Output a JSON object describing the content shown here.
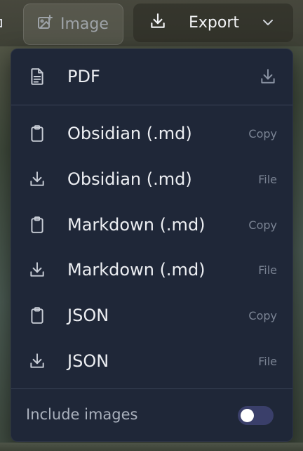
{
  "toolbar": {
    "image_label": "Image",
    "export_label": "Export"
  },
  "menu": {
    "items": [
      {
        "label": "PDF",
        "icon": "file-text-icon",
        "hint": "",
        "right_icon": "download-icon"
      },
      {
        "label": "Obsidian (.md)",
        "icon": "clipboard-icon",
        "hint": "Copy"
      },
      {
        "label": "Obsidian (.md)",
        "icon": "download-icon",
        "hint": "File"
      },
      {
        "label": "Markdown (.md)",
        "icon": "clipboard-icon",
        "hint": "Copy"
      },
      {
        "label": "Markdown (.md)",
        "icon": "download-icon",
        "hint": "File"
      },
      {
        "label": "JSON",
        "icon": "clipboard-icon",
        "hint": "Copy"
      },
      {
        "label": "JSON",
        "icon": "download-icon",
        "hint": "File"
      }
    ],
    "include_images_label": "Include images",
    "include_images_on": false
  },
  "colors": {
    "menu_bg": "#1f2738",
    "toggle_track": "#3a3f6a",
    "hint_text": "#7b8494"
  }
}
